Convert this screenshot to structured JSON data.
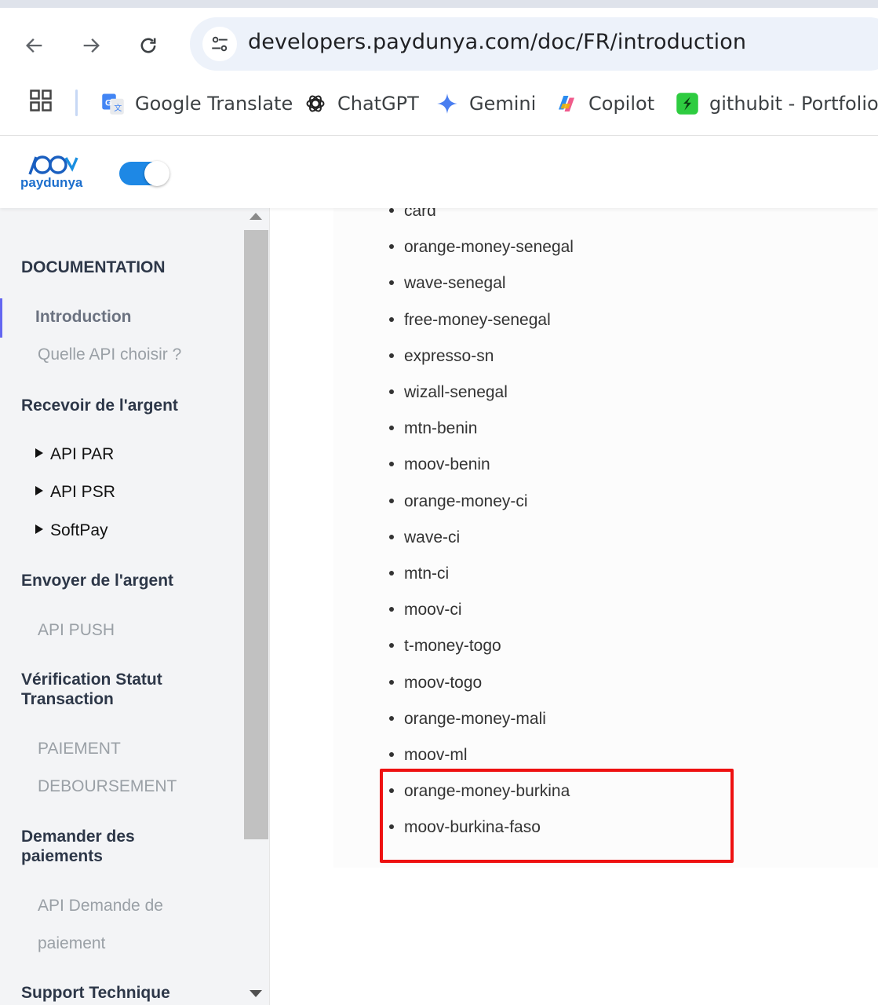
{
  "browser": {
    "url": "developers.paydunya.com/doc/FR/introduction",
    "bookmarks": [
      {
        "label": "Google Translate",
        "icon": "google-translate-icon"
      },
      {
        "label": "ChatGPT",
        "icon": "chatgpt-icon"
      },
      {
        "label": "Gemini",
        "icon": "gemini-icon"
      },
      {
        "label": "Copilot",
        "icon": "copilot-icon"
      },
      {
        "label": "githubit - Portfolio |",
        "icon": "githubit-icon"
      }
    ]
  },
  "header": {
    "logo_text": "paydunya",
    "toggle_on": true
  },
  "sidebar": {
    "documentation": "DOCUMENTATION",
    "introduction": "Introduction",
    "quelle_api": "Quelle API choisir ?",
    "recevoir": "Recevoir de l'argent",
    "api_par": "API PAR",
    "api_psr": "API PSR",
    "softpay": "SoftPay",
    "envoyer": "Envoyer de l'argent",
    "api_push": "API PUSH",
    "verification_line1": "Vérification Statut",
    "verification_line2": "Transaction",
    "paiement": "PAIEMENT",
    "deboursement": "DEBOURSEMENT",
    "demander_line1": "Demander des",
    "demander_line2": "paiements",
    "api_demande_line1": "API Demande de",
    "api_demande_line2": "paiement",
    "support": "Support Technique"
  },
  "content": {
    "items": [
      "card",
      "orange-money-senegal",
      "wave-senegal",
      "free-money-senegal",
      "expresso-sn",
      "wizall-senegal",
      "mtn-benin",
      "moov-benin",
      "orange-money-ci",
      "wave-ci",
      "mtn-ci",
      "moov-ci",
      "t-money-togo",
      "moov-togo",
      "orange-money-mali",
      "moov-ml",
      "orange-money-burkina",
      "moov-burkina-faso"
    ],
    "highlight_color": "#ee1111"
  }
}
